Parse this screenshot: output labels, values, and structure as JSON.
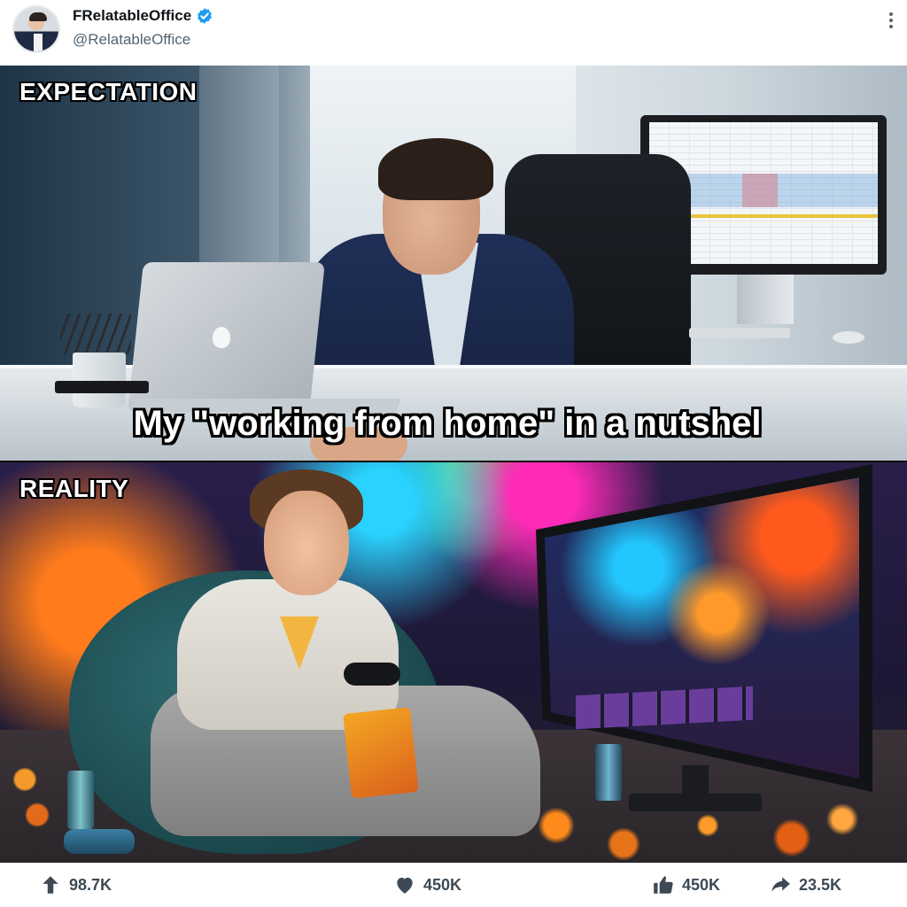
{
  "post": {
    "author_name": "FRelatableOffice",
    "author_handle": "@RelatableOffice",
    "verified": true,
    "icons": {
      "verified": "verified-badge-icon",
      "more": "more-options-icon"
    }
  },
  "meme": {
    "top_label": "EXPECTATION",
    "bottom_label": "REALITY",
    "caption": "My \"working from home\" in a nutshel"
  },
  "actions": {
    "upvotes": "98.7K",
    "likes": "450K",
    "thumbs_up": "450K",
    "shares": "23.5K",
    "icons": [
      "upvote-arrow-icon",
      "heart-icon",
      "thumbs-up-icon",
      "share-arrow-icon"
    ]
  },
  "colors": {
    "verified_blue": "#1d9bf0",
    "action_icon": "#3d4a55",
    "handle_gray": "#536471"
  }
}
